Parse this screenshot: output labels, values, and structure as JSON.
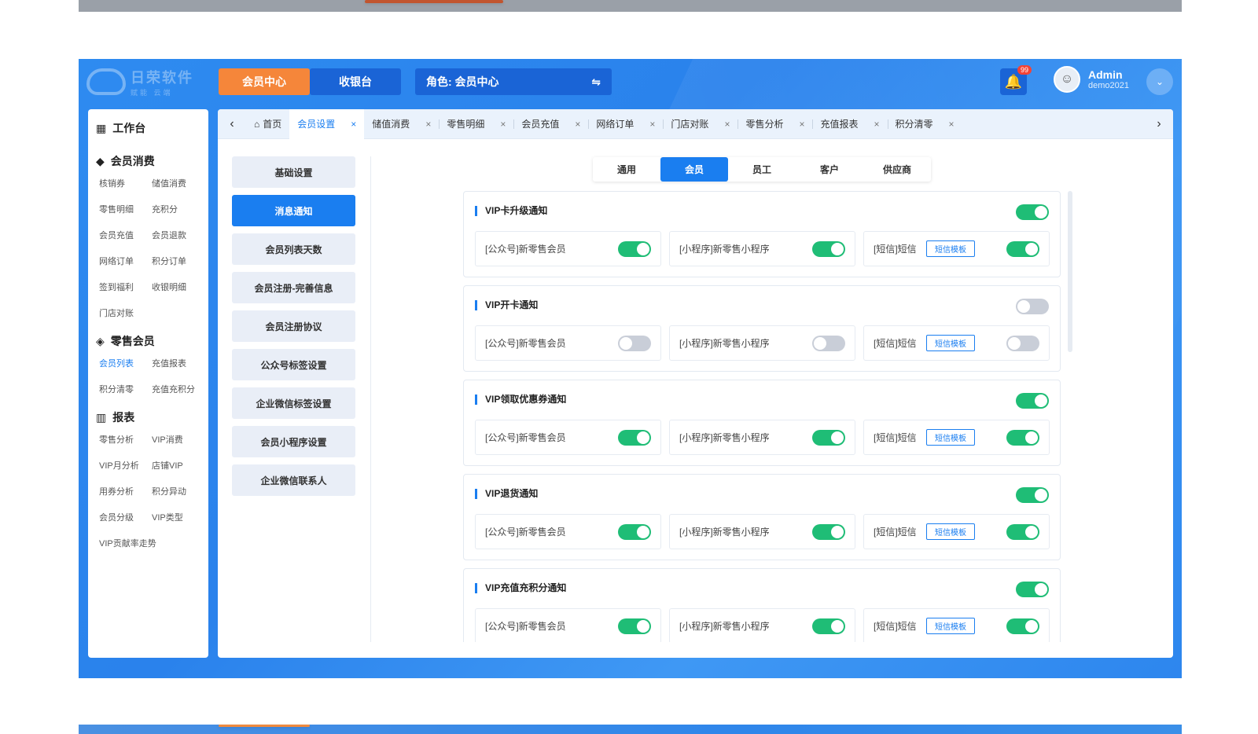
{
  "header": {
    "logo_text": "日荣软件",
    "logo_sub": "赋能 云端",
    "nav": [
      {
        "label": "会员中心",
        "active": true
      },
      {
        "label": "收银台",
        "active": false
      }
    ],
    "role": "角色: 会员中心",
    "role_icon": "swap-icon",
    "notifications_badge": "99",
    "user_name": "Admin",
    "user_sub": "demo2021"
  },
  "sidebar": {
    "title": "工作台",
    "groups": [
      {
        "title": "会员消费",
        "icon": "diamond-icon",
        "items": [
          "核销券",
          "储值消费",
          "零售明细",
          "充积分",
          "会员充值",
          "会员退款",
          "网络订单",
          "积分订单",
          "签到福利",
          "收银明细",
          "门店对账"
        ]
      },
      {
        "title": "零售会员",
        "icon": "tag-icon",
        "items": [
          "会员列表",
          "充值报表",
          "积分清零",
          "充值充积分"
        ],
        "active": "会员列表"
      },
      {
        "title": "报表",
        "icon": "bar-chart-icon",
        "items": [
          "零售分析",
          "VIP消费",
          "VIP月分析",
          "店铺VIP",
          "用券分析",
          "积分异动",
          "会员分级",
          "VIP类型",
          "VIP贡献率走势"
        ]
      }
    ]
  },
  "tabs": [
    {
      "label": "首页",
      "home": true
    },
    {
      "label": "会员设置",
      "active": true
    },
    {
      "label": "储值消费"
    },
    {
      "label": "零售明细"
    },
    {
      "label": "会员充值"
    },
    {
      "label": "网络订单"
    },
    {
      "label": "门店对账"
    },
    {
      "label": "零售分析"
    },
    {
      "label": "充值报表"
    },
    {
      "label": "积分清零"
    }
  ],
  "menu": [
    {
      "label": "基础设置"
    },
    {
      "label": "消息通知",
      "active": true
    },
    {
      "label": "会员列表天数"
    },
    {
      "label": "会员注册-完善信息"
    },
    {
      "label": "会员注册协议"
    },
    {
      "label": "公众号标签设置"
    },
    {
      "label": "企业微信标签设置"
    },
    {
      "label": "会员小程序设置"
    },
    {
      "label": "企业微信联系人"
    }
  ],
  "segments": [
    {
      "label": "通用"
    },
    {
      "label": "会员",
      "active": true
    },
    {
      "label": "员工"
    },
    {
      "label": "客户"
    },
    {
      "label": "供应商"
    }
  ],
  "cards": [
    {
      "title": "VIP卡升级通知",
      "on": true,
      "opts": [
        {
          "label": "[公众号]新零售会员",
          "on": true
        },
        {
          "label": "[小程序]新零售小程序",
          "on": true
        },
        {
          "label": "[短信]短信",
          "on": true,
          "tpl": "短信模板"
        }
      ]
    },
    {
      "title": "VIP开卡通知",
      "on": false,
      "opts": [
        {
          "label": "[公众号]新零售会员",
          "on": false
        },
        {
          "label": "[小程序]新零售小程序",
          "on": false
        },
        {
          "label": "[短信]短信",
          "on": false,
          "tpl": "短信模板"
        }
      ]
    },
    {
      "title": "VIP领取优惠券通知",
      "on": true,
      "opts": [
        {
          "label": "[公众号]新零售会员",
          "on": true
        },
        {
          "label": "[小程序]新零售小程序",
          "on": true
        },
        {
          "label": "[短信]短信",
          "on": true,
          "tpl": "短信模板"
        }
      ]
    },
    {
      "title": "VIP退货通知",
      "on": true,
      "opts": [
        {
          "label": "[公众号]新零售会员",
          "on": true
        },
        {
          "label": "[小程序]新零售小程序",
          "on": true
        },
        {
          "label": "[短信]短信",
          "on": true,
          "tpl": "短信模板"
        }
      ]
    },
    {
      "title": "VIP充值充积分通知",
      "on": true,
      "opts": [
        {
          "label": "[公众号]新零售会员",
          "on": true
        },
        {
          "label": "[小程序]新零售小程序",
          "on": true
        },
        {
          "label": "[短信]短信",
          "on": true,
          "tpl": "短信模板"
        }
      ]
    }
  ]
}
